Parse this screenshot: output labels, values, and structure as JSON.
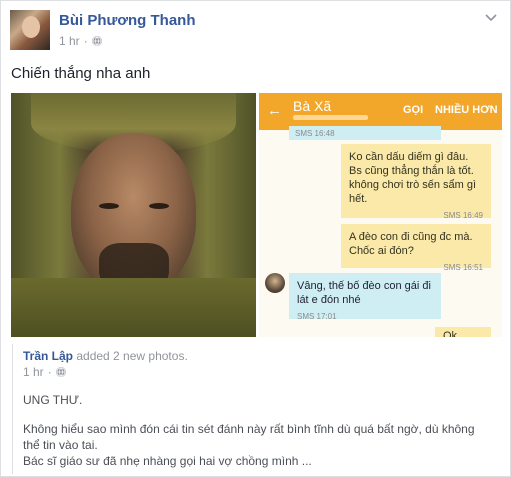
{
  "post": {
    "author": "Bùi Phương Thanh",
    "time": "1 hr",
    "separator": "·",
    "status": "Chiến thắng nha anh"
  },
  "sms": {
    "back": "←",
    "contact": "Bà Xã",
    "call": "GỌI",
    "more": "NHIỀU HƠN",
    "messages": [
      {
        "text": "",
        "time": "SMS 16:48"
      },
      {
        "text": "Ko cần dấu diếm gì đâu. Bs cũng thẳng thắn là tốt. không chơi trò sến sẩm gì hết.",
        "time": "SMS 16:49"
      },
      {
        "text": "A đèo con đi cũng đc mà. Chốc ai đón?",
        "time": "SMS 16:51"
      },
      {
        "text": "Vâng, thế bố đèo con gái đi lát e đón nhé",
        "time": "SMS 17:01"
      },
      {
        "text": "Ok",
        "time": ""
      }
    ]
  },
  "shared": {
    "author": "Trần Lập",
    "action": " added 2 new photos.",
    "time": "1 hr",
    "separator": "·",
    "title": "UNG THƯ.",
    "paragraph1": "Không hiểu sao mình đón cái tin sét đánh này rất bình tĩnh dù quá bất ngờ, dù không thể tin vào tai.",
    "paragraph2": "Bác sĩ giáo sư đã nhẹ nhàng gọi hai vợ chồng mình ..."
  }
}
